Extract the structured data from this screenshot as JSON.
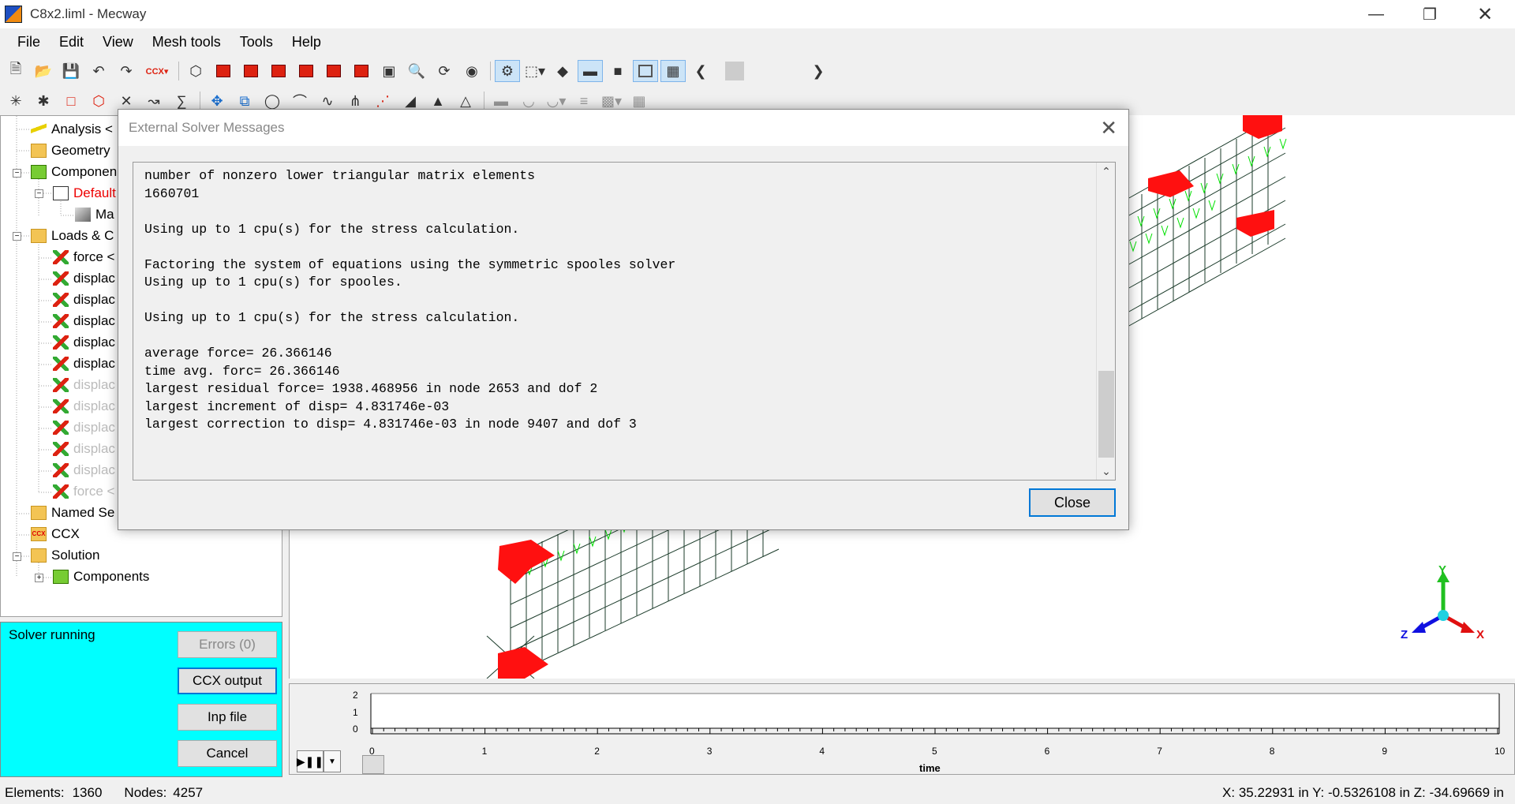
{
  "window": {
    "title": "C8x2.liml - Mecway"
  },
  "menu": [
    "File",
    "Edit",
    "View",
    "Mesh tools",
    "Tools",
    "Help"
  ],
  "tree": {
    "items": [
      {
        "label": "Analysis <",
        "icon": "analysis-bolt-icon",
        "style": "normal"
      },
      {
        "label": "Geometry",
        "icon": "geometry-folder-icon",
        "style": "normal"
      },
      {
        "label": "Componen",
        "icon": "components-icon",
        "style": "normal"
      },
      {
        "label": "Default",
        "icon": "component-default-icon",
        "style": "red"
      },
      {
        "label": "Ma",
        "icon": "material-icon",
        "style": "normal"
      },
      {
        "label": "Loads & C",
        "icon": "loads-folder-icon",
        "style": "normal"
      },
      {
        "label": "force <",
        "icon": "force-arrow-icon",
        "style": "normal"
      },
      {
        "label": "displac",
        "icon": "displacement-arrow-icon",
        "style": "normal"
      },
      {
        "label": "displac",
        "icon": "displacement-arrow-icon",
        "style": "normal"
      },
      {
        "label": "displac",
        "icon": "displacement-arrow-icon",
        "style": "normal"
      },
      {
        "label": "displac",
        "icon": "displacement-arrow-icon",
        "style": "normal"
      },
      {
        "label": "displac",
        "icon": "displacement-arrow-icon",
        "style": "normal"
      },
      {
        "label": "displac",
        "icon": "displacement-arrow-icon",
        "style": "gray"
      },
      {
        "label": "displac",
        "icon": "displacement-arrow-icon",
        "style": "gray"
      },
      {
        "label": "displac",
        "icon": "displacement-arrow-icon",
        "style": "gray"
      },
      {
        "label": "displac",
        "icon": "displacement-arrow-icon",
        "style": "gray"
      },
      {
        "label": "displac",
        "icon": "displacement-arrow-icon",
        "style": "gray"
      },
      {
        "label": "force <",
        "icon": "force-arrow-icon",
        "style": "gray"
      },
      {
        "label": "Named Se",
        "icon": "named-selections-icon",
        "style": "normal"
      },
      {
        "label": "CCX",
        "icon": "ccx-icon",
        "style": "normal"
      },
      {
        "label": "Solution",
        "icon": "solution-icon",
        "style": "normal"
      },
      {
        "label": "Components",
        "icon": "components-icon",
        "style": "normal"
      }
    ]
  },
  "solver": {
    "status": "Solver running",
    "errors_label": "Errors (0)",
    "ccx_output_label": "CCX output",
    "inp_file_label": "Inp file",
    "cancel_label": "Cancel"
  },
  "timeline": {
    "y_ticks": [
      "2",
      "1",
      "0"
    ],
    "x_ticks": [
      "0",
      "1",
      "2",
      "3",
      "4",
      "5",
      "6",
      "7",
      "8",
      "9",
      "10"
    ],
    "x_label": "time"
  },
  "axes_triad": {
    "x": "X",
    "y": "Y",
    "z": "Z"
  },
  "statusbar": {
    "elements_label": "Elements:",
    "elements_count": "1360",
    "nodes_label": "Nodes:",
    "nodes_count": "4257",
    "coords": "X: 35.22931 in Y: -0.5326108 in Z: -34.69669 in"
  },
  "dialog": {
    "title": "External Solver Messages",
    "lines": [
      "number of nonzero lower triangular matrix elements",
      "1660701",
      "",
      "Using up to 1 cpu(s) for the stress calculation.",
      "",
      "Factoring the system of equations using the symmetric spooles solver",
      "Using up to 1 cpu(s) for spooles.",
      "",
      "Using up to 1 cpu(s) for the stress calculation.",
      "",
      "average force= 26.366146",
      "time avg. forc= 26.366146",
      "largest residual force= 1938.468956 in node 2653 and dof 2",
      "largest increment of disp= 4.831746e-03",
      "largest correction to disp= 4.831746e-03 in node 9407 and dof 3"
    ],
    "close_label": "Close"
  }
}
